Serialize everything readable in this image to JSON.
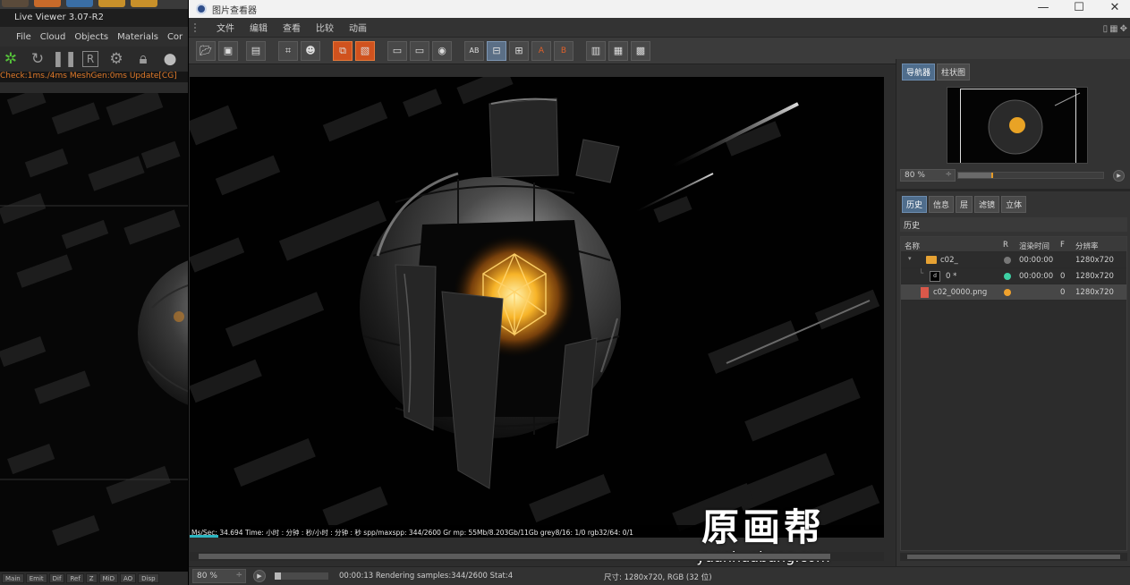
{
  "live_viewer": {
    "title": "Live Viewer 3.07-R2",
    "menu": [
      "File",
      "Cloud",
      "Objects",
      "Materials",
      "Cor"
    ],
    "stats": "Check:1ms./4ms  MeshGen:0ms  Update[CG]",
    "bottom_tabs": [
      "Main",
      "Emit",
      "Dif",
      "Ref",
      "Z",
      "MiD",
      "AO",
      "Disp"
    ],
    "toolbar_icons": [
      "octane-icon",
      "refresh-icon",
      "pause-icon",
      "r-icon",
      "gear-icon",
      "lock-icon",
      "sphere-icon"
    ]
  },
  "picture_viewer": {
    "title": "图片查看器",
    "menu": [
      "文件",
      "编辑",
      "查看",
      "比较",
      "动画"
    ],
    "toolbar_icons": [
      "open-icon",
      "save-icon",
      "film-icon",
      "region-icon",
      "user-icon",
      "copy-icon",
      "paste-icon",
      "frame-a-icon",
      "frame-b-icon",
      "frame-ab-icon",
      "ab-icon",
      "split-icon",
      "histogram-icon",
      "set-a-icon",
      "set-b-icon",
      "compare-1-icon",
      "compare-2-icon",
      "compare-3-icon"
    ],
    "hud": "Ms/Sec: 34.694   Time: 小时 : 分钟 : 秒/小时 : 分钟 : 秒    spp/maxspp: 344/2600    Gr         mp:              55Mb/8.203Gb/11Gb    grey8/16: 1/0    rgb32/64: 0/1",
    "statusbar": {
      "zoom": "80 %",
      "progress": 0.12,
      "render_status": "00:00:13 Rendering samples:344/2600 Stat:4",
      "size_info": "尺寸: 1280x720, RGB (32 位)"
    }
  },
  "right_panel": {
    "nav_tabs": [
      "导航器",
      "柱状图"
    ],
    "nav_zoom": "80 %",
    "nav_slider": 0.24,
    "hist_tabs": [
      "历史",
      "信息",
      "层",
      "滤镜",
      "立体"
    ],
    "hist_header": "历史",
    "columns": [
      "名称",
      "R",
      "渲染时间",
      "F",
      "分辨率"
    ],
    "rows": [
      {
        "name": "c02_",
        "render_time": "00:00:00",
        "frame": "",
        "resolution": "1280x720",
        "status_color": "#777777"
      },
      {
        "name": "0 *",
        "render_time": "00:00:00",
        "frame": "0",
        "resolution": "1280x720",
        "status_color": "#3ed0a4"
      },
      {
        "name": "c02_0000.png",
        "render_time": "",
        "frame": "0",
        "resolution": "1280x720",
        "status_color": "#f0a22d"
      }
    ]
  },
  "watermark": {
    "big": "原画帮",
    "small": "yuanhuabang.com"
  },
  "colors": {
    "accent_orange": "#d0521e",
    "tab_active": "#4f6d8c",
    "hud_progress": "#2bb6c2"
  }
}
